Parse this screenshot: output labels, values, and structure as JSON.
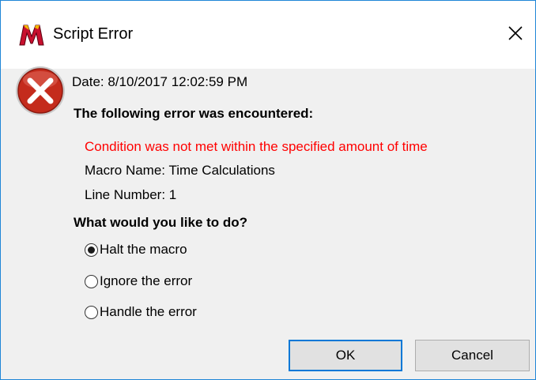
{
  "window": {
    "title": "Script Error"
  },
  "error": {
    "date_line": "Date: 8/10/2017 12:02:59 PM",
    "heading": "The following error was encountered:",
    "message": "Condition was not met within the specified amount of time",
    "macro_name": "Macro Name: Time Calculations",
    "line_number": "Line Number: 1"
  },
  "question": "What would you like to do?",
  "options": [
    {
      "label": "Halt the macro",
      "selected": true
    },
    {
      "label": "Ignore the error",
      "selected": false
    },
    {
      "label": "Handle the error",
      "selected": false
    }
  ],
  "buttons": {
    "ok": "OK",
    "cancel": "Cancel"
  },
  "colors": {
    "error_text": "#ff0000",
    "accent": "#0078d7",
    "error_icon": "#c42b1c"
  },
  "icons": {
    "app": "app-m-logo-icon",
    "close": "close-icon",
    "error": "error-x-icon"
  }
}
